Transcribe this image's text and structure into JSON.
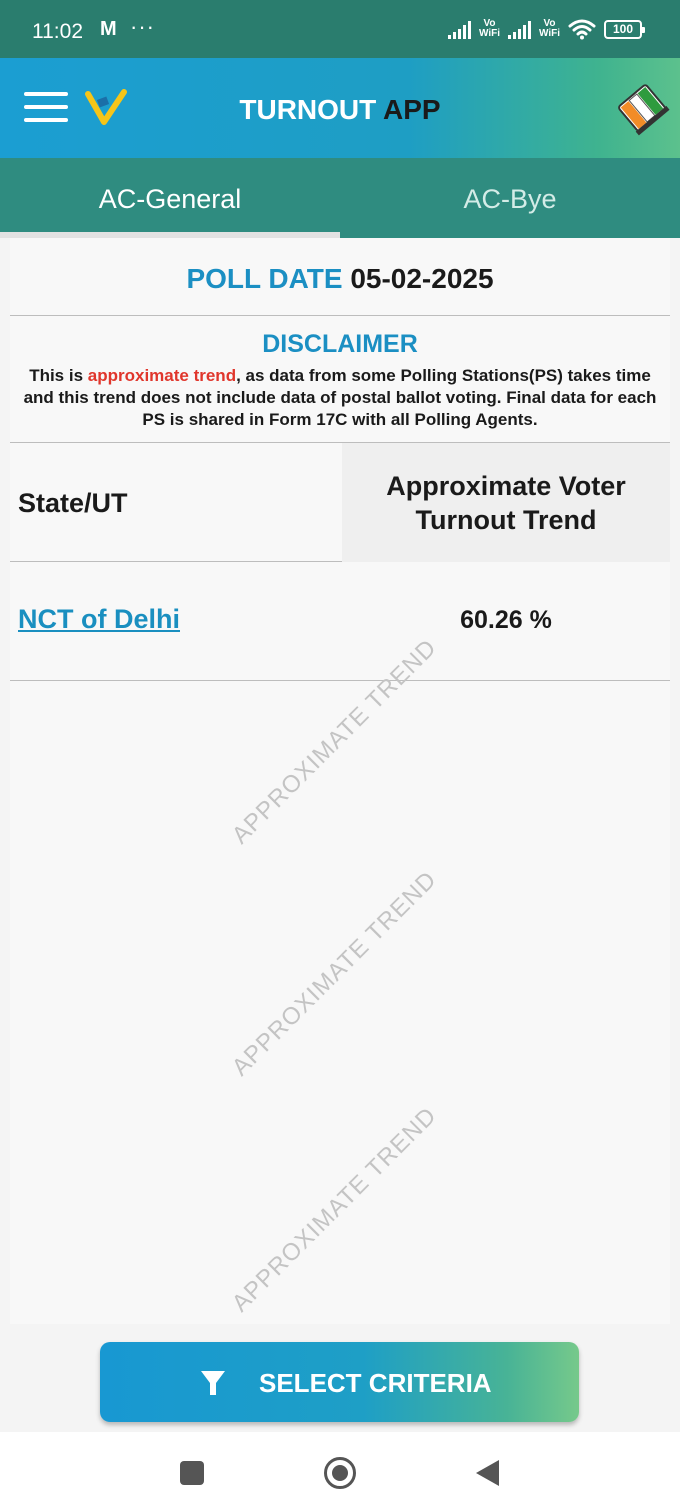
{
  "status_bar": {
    "time": "11:02",
    "mail_glyph": "M",
    "more_dots": "···",
    "vowifi_top": "Vo",
    "vowifi_bottom": "WiFi",
    "battery": "100"
  },
  "header": {
    "title_part1": "TURNOUT",
    "title_part2": "APP"
  },
  "tabs": [
    {
      "label": "AC-General",
      "selected": true
    },
    {
      "label": "AC-Bye",
      "selected": false
    }
  ],
  "poll": {
    "label": "POLL DATE",
    "date": "05-02-2025"
  },
  "disclaimer": {
    "title": "DISCLAIMER",
    "text_before": "This is ",
    "highlight": "approximate trend",
    "text_after": ", as data from some Polling Stations(PS) takes time and this trend does not include data of postal ballot voting. Final data for each PS is shared in Form 17C with all Polling Agents."
  },
  "table": {
    "col_state": "State/UT",
    "col_trend_line1": "Approximate Voter",
    "col_trend_line2": "Turnout Trend",
    "rows": [
      {
        "state": "NCT of Delhi",
        "value": "60.26 %"
      }
    ]
  },
  "watermark": {
    "text": "APPROXIMATE TREND"
  },
  "select_button": {
    "label": "SELECT CRITERIA"
  },
  "colors": {
    "status_bar": "#2a7d6e",
    "header_blue": "#1b9ed2",
    "header_green": "#5cc18d",
    "tab_bar": "#2f8c80",
    "accent_blue": "#1b8fc3",
    "highlight_red": "#e0362c"
  }
}
